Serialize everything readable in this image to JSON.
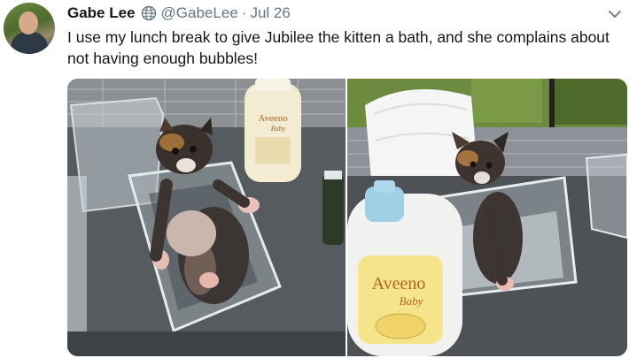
{
  "tweet": {
    "author": {
      "display_name": "Gabe Lee",
      "handle": "@GabeLee",
      "verified_icon": "globe-icon"
    },
    "separator": "·",
    "date": "Jul 26",
    "text": "I use my lunch break to give Jubilee the kitten a bath, and she complains about not having enough bubbles!",
    "menu_icon": "chevron-down-icon",
    "media": [
      {
        "kind": "photo",
        "bottle_brand": "Aveeno",
        "bottle_sub": "Baby"
      },
      {
        "kind": "photo",
        "bottle_brand": "Aveeno",
        "bottle_sub": "Baby"
      }
    ]
  },
  "colors": {
    "name": "#14171a",
    "secondary": "#657786",
    "link_blue": "#1da1f2"
  }
}
